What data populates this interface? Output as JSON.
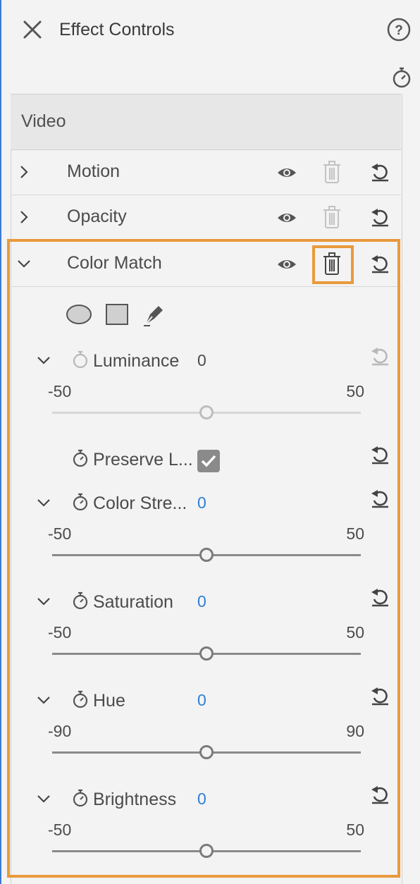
{
  "header": {
    "title": "Effect Controls"
  },
  "section": {
    "label": "Video"
  },
  "effects": [
    {
      "label": "Motion",
      "expanded": false
    },
    {
      "label": "Opacity",
      "expanded": false
    },
    {
      "label": "Color Match",
      "expanded": true
    }
  ],
  "color_match": {
    "mask_tools": [
      "ellipse-mask-icon",
      "rectangle-mask-icon",
      "pen-mask-icon"
    ],
    "params": [
      {
        "name": "Luminance",
        "value": "0",
        "min": "-50",
        "max": "50",
        "position": 0.5,
        "enabled": false
      },
      {
        "name": "Preserve L...",
        "checked": true
      },
      {
        "name": "Color Stre...",
        "value": "0",
        "min": "-50",
        "max": "50",
        "position": 0.5,
        "enabled": true
      },
      {
        "name": "Saturation",
        "value": "0",
        "min": "-50",
        "max": "50",
        "position": 0.5,
        "enabled": true
      },
      {
        "name": "Hue",
        "value": "0",
        "min": "-90",
        "max": "90",
        "position": 0.5,
        "enabled": true
      },
      {
        "name": "Brightness",
        "value": "0",
        "min": "-50",
        "max": "50",
        "position": 0.5,
        "enabled": true
      }
    ]
  },
  "colors": {
    "accent_value": "#2d7fd6",
    "highlight": "#e99a3c",
    "disabled": "#b8b8b8"
  }
}
